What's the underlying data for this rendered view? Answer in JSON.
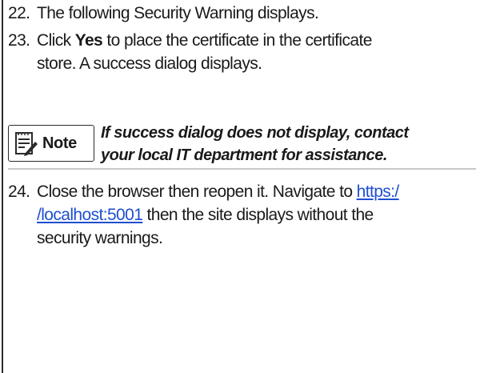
{
  "steps": [
    {
      "number": "22.",
      "text": "The following Security Warning displays."
    },
    {
      "number": "23.",
      "pre": "Click ",
      "bold": "Yes",
      "post": " to place the certificate in the certificate",
      "line2": "store. A success dialog displays."
    },
    {
      "number": "24.",
      "pre": "Close the browser then reopen it. Navigate to ",
      "link_part1": "https:/",
      "link_part2": "/localhost:5001",
      "post": " then the site displays without the",
      "line3": "security warnings."
    }
  ],
  "note": {
    "label": "Note",
    "icon": "note-pad-icon",
    "line1": "If success dialog does not display, contact",
    "line2": "your local IT department for assistance."
  },
  "colors": {
    "link": "#1f4fd1",
    "border": "#2b2b2b"
  }
}
